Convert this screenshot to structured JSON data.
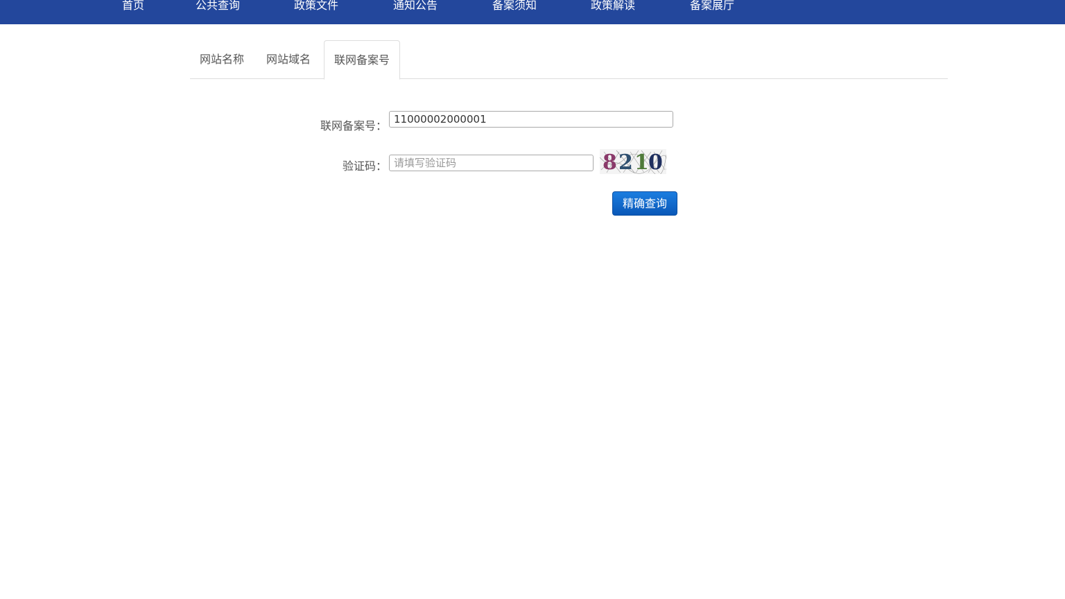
{
  "nav": {
    "items": [
      {
        "label": "首页"
      },
      {
        "label": "公共查询"
      },
      {
        "label": "政策文件"
      },
      {
        "label": "通知公告"
      },
      {
        "label": "备案须知"
      },
      {
        "label": "政策解读"
      },
      {
        "label": "备案展厅"
      }
    ]
  },
  "tabs": [
    {
      "label": "网站名称",
      "active": false
    },
    {
      "label": "网站域名",
      "active": false
    },
    {
      "label": "联网备案号",
      "active": true
    }
  ],
  "form": {
    "record_label": "联网备案号：",
    "record_value": "11000002000001",
    "captcha_label": "验证码：",
    "captcha_placeholder": "请填写验证码",
    "captcha_image_text": "8210",
    "submit_label": "精确查询"
  },
  "colors": {
    "nav_bg": "#23479c",
    "button_bg": "#0a58b8"
  }
}
